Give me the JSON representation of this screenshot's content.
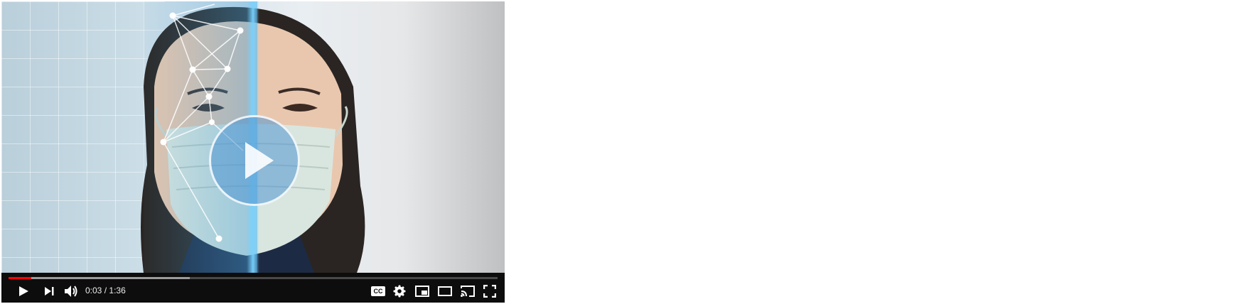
{
  "player": {
    "current_time": "0:03",
    "separator": "/",
    "duration": "1:36",
    "progress": {
      "played_fraction": 0.047,
      "loaded_fraction": 0.37
    },
    "accent_color": "#ff0000",
    "icons": {
      "big_play": "play-icon",
      "play": "play-icon",
      "next": "next-icon",
      "volume": "volume-icon",
      "captions": "cc-icon",
      "settings": "gear-icon",
      "miniplayer": "miniplayer-icon",
      "theater": "theater-mode-icon",
      "cast": "cast-icon",
      "fullscreen": "fullscreen-icon"
    },
    "captions_label": "CC"
  }
}
